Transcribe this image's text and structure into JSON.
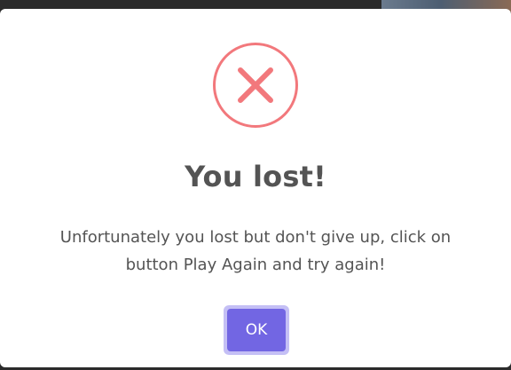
{
  "dialog": {
    "title": "You lost!",
    "message": "Unfortunately you lost but don't give up, click on button Play Again and try again!",
    "ok_label": "OK",
    "icon": "error-x-icon"
  },
  "colors": {
    "icon": "#f2787c",
    "text": "#545454",
    "button": "#7266e3",
    "button_focus_ring": "#c4bff5",
    "backdrop": "#2b2b2b"
  }
}
